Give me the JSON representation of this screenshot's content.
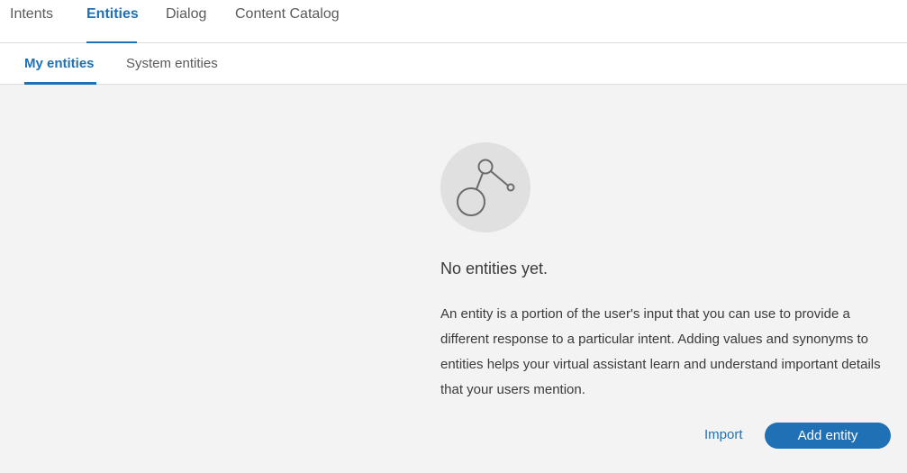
{
  "top_nav": {
    "tabs": [
      {
        "label": "Intents",
        "active": false
      },
      {
        "label": "Entities",
        "active": true
      },
      {
        "label": "Dialog",
        "active": false
      },
      {
        "label": "Content Catalog",
        "active": false
      }
    ]
  },
  "sub_nav": {
    "tabs": [
      {
        "label": "My entities",
        "active": true
      },
      {
        "label": "System entities",
        "active": false
      }
    ]
  },
  "empty_state": {
    "icon": "entity-graph-icon",
    "title": "No entities yet.",
    "description": "An entity is a portion of the user's input that you can use to provide a different response to a particular intent. Adding values and synonyms to entities helps your virtual assistant learn and understand important details that your users mention.",
    "import_label": "Import",
    "add_label": "Add entity"
  },
  "colors": {
    "accent": "#1f70b5",
    "background": "#f3f3f3",
    "icon_circle": "#e0e0e0"
  }
}
